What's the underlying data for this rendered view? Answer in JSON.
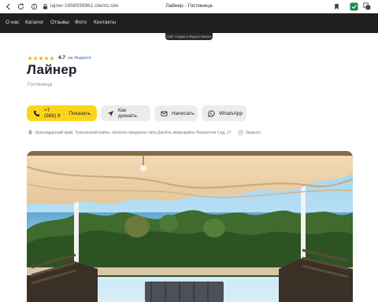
{
  "browser": {
    "url": "lajner-1658939961.clients.site",
    "title": "Лайнер - Гостиница"
  },
  "nav": {
    "items": [
      "О нас",
      "Каталог",
      "Отзывы",
      "Фото",
      "Контакты"
    ]
  },
  "badge": "Сайт создан в Яндекс Бизнес",
  "rating": {
    "value": "4.7",
    "on_label": "на",
    "source": "Яндексе",
    "stars": 5,
    "star_color": "#f5b800"
  },
  "business": {
    "name": "Лайнер",
    "category": "Гостиница"
  },
  "actions": {
    "phone_masked": "+7 (988) 8",
    "phone_show": "Показать",
    "route": "Как доехать",
    "write": "Написать",
    "whatsapp": "WhatsApp"
  },
  "address": {
    "text": "Краснодарский край, Туапсинский район, посёлок городского типа Джубга, микрорайон Лермонтов Сад, 27",
    "status": "Закрыто"
  },
  "colors": {
    "nav_bg": "#1f1f1f",
    "call_button": "#fcd41c",
    "secondary_button": "#ececef",
    "link_blue": "#2b6fd6"
  },
  "photo": {
    "subject": "terrace-awning-sea-view"
  }
}
